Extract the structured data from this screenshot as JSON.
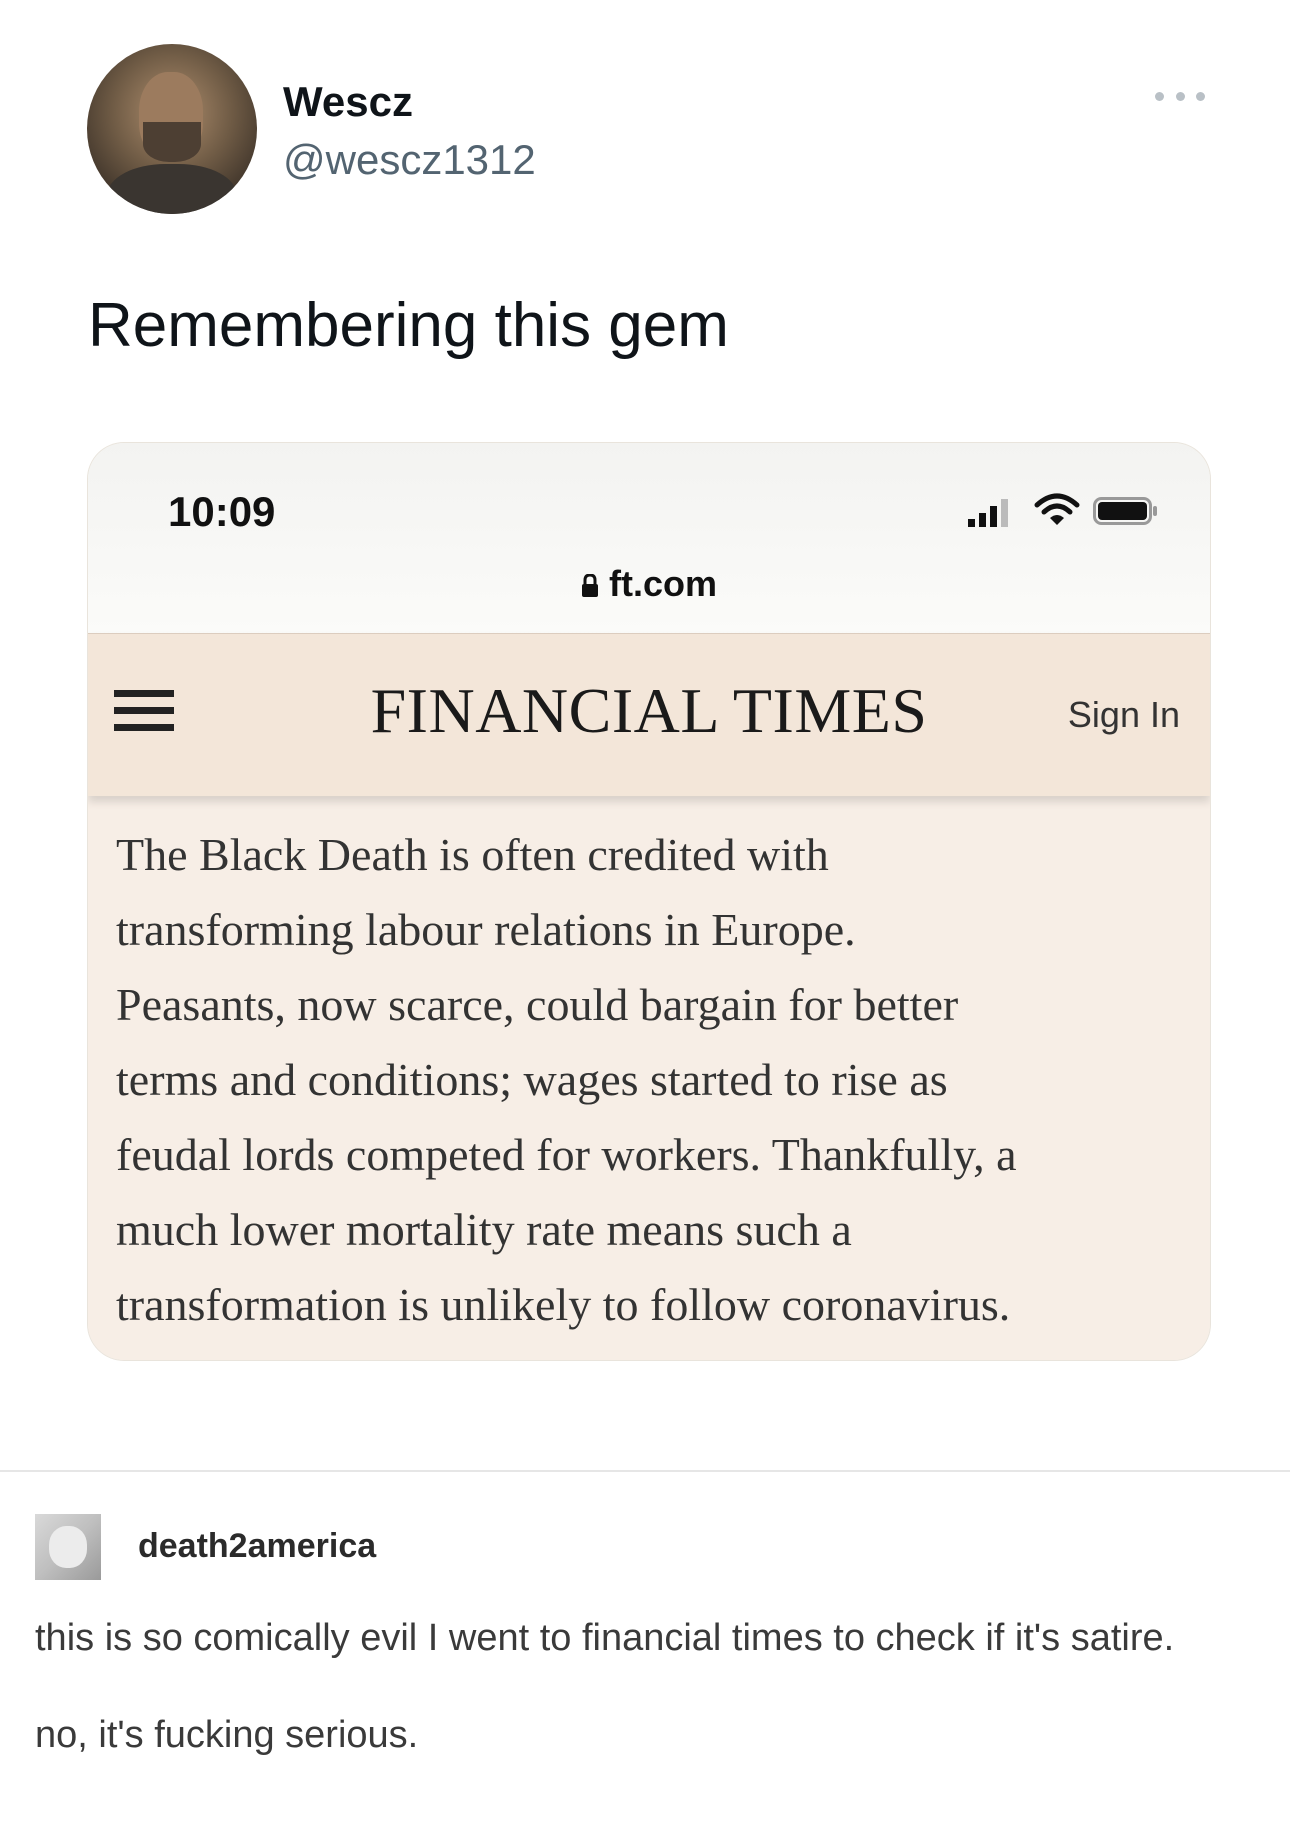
{
  "tweet": {
    "display_name": "Wescz",
    "handle": "@wescz1312",
    "text": "Remembering this gem",
    "more_icon": "more-horizontal-icon"
  },
  "media": {
    "status_bar": {
      "time": "10:09",
      "icons": [
        "signal-icon",
        "wifi-icon",
        "battery-icon"
      ]
    },
    "url": "ft.com",
    "header": {
      "logo": "FINANCIAL TIMES",
      "sign_in": "Sign In",
      "menu_icon": "hamburger-menu-icon"
    },
    "article_lines": [
      "The Black Death is often credited with",
      "transforming labour relations in Europe.",
      "Peasants, now scarce, could bargain for better",
      "terms and conditions; wages started to rise as",
      "feudal lords competed for workers. Thankfully, a",
      "much lower mortality rate means such a",
      "transformation is unlikely to follow coronavirus."
    ],
    "colors": {
      "header_bg": "#f3e6d9",
      "article_bg": "#f7eee6"
    }
  },
  "reblog": {
    "username": "death2america",
    "lines": [
      "this is so comically evil I went to financial times to check if it's satire.",
      "no, it's fucking serious."
    ]
  }
}
